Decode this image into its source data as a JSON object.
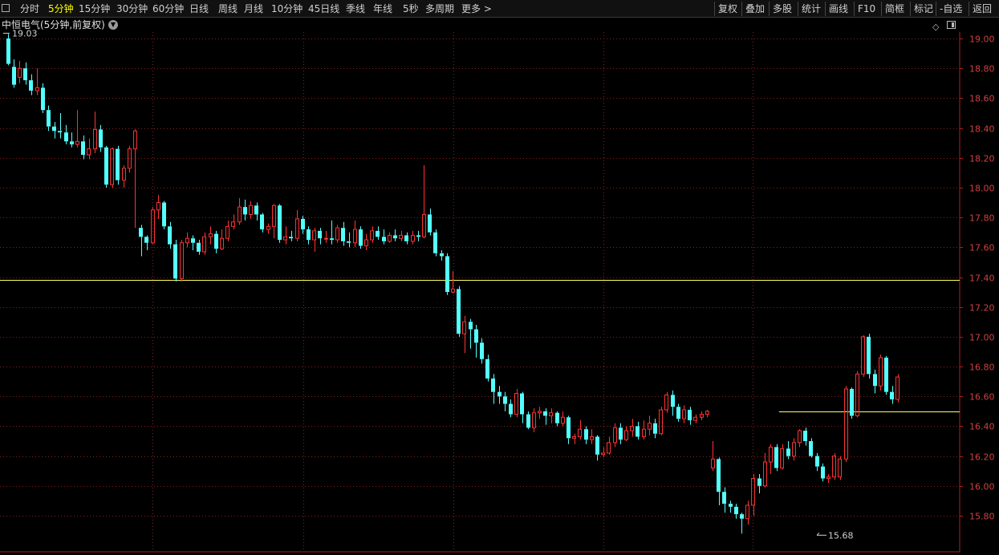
{
  "toolbar": {
    "periods": [
      "分时",
      "5分钟",
      "15分钟",
      "30分钟",
      "60分钟",
      "日线",
      "周线",
      "月线",
      "10分钟",
      "45日线",
      "季线",
      "年线",
      "5秒",
      "多周期",
      "更多 >"
    ],
    "active_period": "5分钟",
    "right_buttons": [
      "复权",
      "叠加",
      "多股",
      "统计",
      "画线",
      "F10",
      "简框",
      "标记",
      "-自选",
      "返回"
    ]
  },
  "title_row": {
    "title": "中恒电气(5分钟,前复权)"
  },
  "colors": {
    "background": "#000000",
    "up": "#ff3232",
    "down": "#54ffff",
    "grid": "#8a1e1e",
    "axis_text": "#d04040",
    "hline": "#ffff66",
    "active": "#ffff00"
  },
  "chart_data": {
    "type": "candlestick",
    "ylim": [
      15.65,
      19.12
    ],
    "y_ticks": [
      "19.00",
      "18.80",
      "18.60",
      "18.40",
      "18.20",
      "18.00",
      "17.80",
      "17.60",
      "17.40",
      "17.20",
      "17.00",
      "16.80",
      "16.60",
      "16.40",
      "16.20",
      "16.00",
      "15.80"
    ],
    "grid": true,
    "max_marker": {
      "label": "19.03",
      "value": 19.03,
      "index": 0
    },
    "min_marker": {
      "label": "15.68",
      "value": 15.68,
      "index": 140
    },
    "horizontal_lines": [
      {
        "value": 17.38,
        "from_index": 0,
        "to_index": 170
      },
      {
        "value": 16.5,
        "from_index": 134,
        "to_index": 170
      }
    ],
    "candles": [
      [
        19.0,
        18.83,
        19.03,
        18.82
      ],
      [
        18.81,
        18.69,
        18.86,
        18.67
      ],
      [
        18.74,
        18.8,
        18.85,
        18.7
      ],
      [
        18.8,
        18.72,
        18.84,
        18.69
      ],
      [
        18.72,
        18.65,
        18.76,
        18.62
      ],
      [
        18.65,
        18.67,
        18.8,
        18.62
      ],
      [
        18.67,
        18.52,
        18.7,
        18.5
      ],
      [
        18.52,
        18.41,
        18.55,
        18.38
      ],
      [
        18.41,
        18.38,
        18.44,
        18.33
      ],
      [
        18.38,
        18.37,
        18.5,
        18.33
      ],
      [
        18.37,
        18.31,
        18.42,
        18.29
      ],
      [
        18.31,
        18.29,
        18.37,
        18.27
      ],
      [
        18.29,
        18.31,
        18.52,
        18.27
      ],
      [
        18.31,
        18.22,
        18.35,
        18.19
      ],
      [
        18.22,
        18.26,
        18.33,
        18.19
      ],
      [
        18.26,
        18.39,
        18.51,
        18.23
      ],
      [
        18.39,
        18.27,
        18.42,
        18.24
      ],
      [
        18.27,
        18.02,
        18.28,
        18.0
      ],
      [
        18.02,
        18.26,
        18.27,
        18.0
      ],
      [
        18.26,
        18.05,
        18.28,
        18.02
      ],
      [
        18.05,
        18.13,
        18.15,
        18.0
      ],
      [
        18.13,
        18.26,
        18.28,
        18.1
      ],
      [
        18.26,
        18.38,
        18.39,
        17.73
      ],
      [
        17.73,
        17.67,
        17.75,
        17.54
      ],
      [
        17.67,
        17.63,
        17.68,
        17.58
      ],
      [
        17.63,
        17.85,
        17.87,
        17.62
      ],
      [
        17.85,
        17.9,
        17.95,
        17.79
      ],
      [
        17.9,
        17.74,
        17.91,
        17.72
      ],
      [
        17.74,
        17.62,
        17.77,
        17.59
      ],
      [
        17.62,
        17.39,
        17.65,
        17.37
      ],
      [
        17.39,
        17.63,
        17.65,
        17.37
      ],
      [
        17.63,
        17.66,
        17.7,
        17.6
      ],
      [
        17.66,
        17.63,
        17.68,
        17.58
      ],
      [
        17.63,
        17.57,
        17.65,
        17.55
      ],
      [
        17.57,
        17.67,
        17.7,
        17.55
      ],
      [
        17.67,
        17.69,
        17.74,
        17.62
      ],
      [
        17.69,
        17.59,
        17.71,
        17.56
      ],
      [
        17.59,
        17.66,
        17.72,
        17.58
      ],
      [
        17.66,
        17.74,
        17.78,
        17.64
      ],
      [
        17.74,
        17.77,
        17.82,
        17.72
      ],
      [
        17.77,
        17.87,
        17.93,
        17.75
      ],
      [
        17.87,
        17.82,
        17.92,
        17.78
      ],
      [
        17.82,
        17.88,
        17.91,
        17.79
      ],
      [
        17.88,
        17.82,
        17.9,
        17.78
      ],
      [
        17.82,
        17.72,
        17.83,
        17.7
      ],
      [
        17.72,
        17.74,
        17.76,
        17.69
      ],
      [
        17.74,
        17.88,
        17.89,
        17.66
      ],
      [
        17.88,
        17.65,
        17.89,
        17.63
      ],
      [
        17.65,
        17.67,
        17.74,
        17.62
      ],
      [
        17.67,
        17.66,
        17.71,
        17.64
      ],
      [
        17.66,
        17.79,
        17.85,
        17.64
      ],
      [
        17.79,
        17.72,
        17.81,
        17.69
      ],
      [
        17.72,
        17.65,
        17.74,
        17.62
      ],
      [
        17.65,
        17.71,
        17.73,
        17.57
      ],
      [
        17.71,
        17.66,
        17.73,
        17.62
      ],
      [
        17.66,
        17.66,
        17.71,
        17.63
      ],
      [
        17.66,
        17.65,
        17.78,
        17.62
      ],
      [
        17.65,
        17.73,
        17.75,
        17.63
      ],
      [
        17.73,
        17.64,
        17.77,
        17.61
      ],
      [
        17.64,
        17.63,
        17.7,
        17.6
      ],
      [
        17.63,
        17.72,
        17.78,
        17.6
      ],
      [
        17.72,
        17.61,
        17.74,
        17.59
      ],
      [
        17.61,
        17.65,
        17.69,
        17.58
      ],
      [
        17.65,
        17.71,
        17.74,
        17.63
      ],
      [
        17.71,
        17.67,
        17.74,
        17.65
      ],
      [
        17.67,
        17.64,
        17.72,
        17.62
      ],
      [
        17.64,
        17.68,
        17.7,
        17.63
      ],
      [
        17.68,
        17.66,
        17.72,
        17.64
      ],
      [
        17.66,
        17.68,
        17.71,
        17.64
      ],
      [
        17.68,
        17.64,
        17.7,
        17.62
      ],
      [
        17.64,
        17.68,
        17.71,
        17.62
      ],
      [
        17.68,
        17.67,
        17.71,
        17.64
      ],
      [
        17.67,
        17.82,
        18.15,
        17.66
      ],
      [
        17.82,
        17.7,
        17.86,
        17.68
      ],
      [
        17.7,
        17.56,
        17.72,
        17.54
      ],
      [
        17.56,
        17.54,
        17.58,
        17.51
      ],
      [
        17.54,
        17.3,
        17.56,
        17.28
      ],
      [
        17.3,
        17.32,
        17.44,
        17.29
      ],
      [
        17.32,
        17.02,
        17.34,
        17.0
      ],
      [
        17.02,
        17.1,
        17.14,
        16.89
      ],
      [
        17.1,
        17.05,
        17.12,
        16.92
      ],
      [
        17.05,
        16.96,
        17.08,
        16.86
      ],
      [
        16.96,
        16.85,
        16.99,
        16.82
      ],
      [
        16.85,
        16.72,
        16.88,
        16.7
      ],
      [
        16.72,
        16.63,
        16.75,
        16.55
      ],
      [
        16.63,
        16.6,
        16.67,
        16.55
      ],
      [
        16.6,
        16.55,
        16.63,
        16.5
      ],
      [
        16.55,
        16.48,
        16.58,
        16.46
      ],
      [
        16.48,
        16.62,
        16.65,
        16.46
      ],
      [
        16.62,
        16.48,
        16.63,
        16.42
      ],
      [
        16.48,
        16.39,
        16.5,
        16.38
      ],
      [
        16.39,
        16.49,
        16.52,
        16.36
      ],
      [
        16.49,
        16.5,
        16.53,
        16.45
      ],
      [
        16.5,
        16.47,
        16.52,
        16.41
      ],
      [
        16.47,
        16.49,
        16.52,
        16.42
      ],
      [
        16.49,
        16.42,
        16.5,
        16.4
      ],
      [
        16.42,
        16.46,
        16.5,
        16.4
      ],
      [
        16.46,
        16.32,
        16.47,
        16.28
      ],
      [
        16.32,
        16.33,
        16.35,
        16.28
      ],
      [
        16.33,
        16.38,
        16.44,
        16.31
      ],
      [
        16.38,
        16.31,
        16.4,
        16.28
      ],
      [
        16.31,
        16.33,
        16.38,
        16.28
      ],
      [
        16.33,
        16.21,
        16.34,
        16.17
      ],
      [
        16.21,
        16.22,
        16.26,
        16.19
      ],
      [
        16.22,
        16.29,
        16.33,
        16.21
      ],
      [
        16.29,
        16.39,
        16.42,
        16.26
      ],
      [
        16.39,
        16.31,
        16.42,
        16.28
      ],
      [
        16.31,
        16.37,
        16.4,
        16.3
      ],
      [
        16.37,
        16.4,
        16.45,
        16.33
      ],
      [
        16.4,
        16.33,
        16.43,
        16.31
      ],
      [
        16.33,
        16.38,
        16.44,
        16.31
      ],
      [
        16.38,
        16.42,
        16.47,
        16.34
      ],
      [
        16.42,
        16.35,
        16.45,
        16.32
      ],
      [
        16.35,
        16.51,
        16.53,
        16.34
      ],
      [
        16.51,
        16.61,
        16.63,
        16.49
      ],
      [
        16.61,
        16.53,
        16.64,
        16.47
      ],
      [
        16.53,
        16.45,
        16.55,
        16.43
      ],
      [
        16.45,
        16.51,
        16.54,
        16.42
      ],
      [
        16.51,
        16.44,
        16.53,
        16.41
      ],
      [
        16.44,
        16.46,
        16.48,
        16.42
      ],
      [
        16.46,
        16.48,
        16.5,
        16.44
      ],
      [
        16.48,
        16.5,
        16.51,
        16.46
      ],
      [
        16.12,
        16.18,
        16.3,
        16.1
      ],
      [
        16.18,
        15.96,
        16.19,
        15.87
      ],
      [
        15.96,
        15.88,
        15.99,
        15.82
      ],
      [
        15.88,
        15.86,
        15.9,
        15.82
      ],
      [
        15.86,
        15.81,
        15.88,
        15.78
      ],
      [
        15.81,
        15.78,
        15.82,
        15.68
      ],
      [
        15.78,
        15.87,
        15.9,
        15.74
      ],
      [
        15.87,
        16.05,
        16.08,
        15.8
      ],
      [
        16.05,
        16.0,
        16.08,
        15.95
      ],
      [
        16.0,
        16.16,
        16.22,
        15.99
      ],
      [
        16.16,
        16.26,
        16.28,
        16.08
      ],
      [
        16.26,
        16.12,
        16.28,
        16.1
      ],
      [
        16.12,
        16.25,
        16.28,
        16.11
      ],
      [
        16.25,
        16.2,
        16.3,
        16.18
      ],
      [
        16.2,
        16.29,
        16.32,
        16.17
      ],
      [
        16.29,
        16.37,
        16.38,
        16.26
      ],
      [
        16.37,
        16.3,
        16.39,
        16.27
      ],
      [
        16.3,
        16.2,
        16.32,
        16.19
      ],
      [
        16.2,
        16.13,
        16.22,
        16.1
      ],
      [
        16.13,
        16.05,
        16.15,
        16.03
      ],
      [
        16.05,
        16.06,
        16.08,
        16.02
      ],
      [
        16.06,
        16.2,
        16.22,
        16.04
      ],
      [
        16.06,
        16.18,
        16.2,
        16.04
      ],
      [
        16.18,
        16.65,
        16.67,
        16.16
      ],
      [
        16.65,
        16.47,
        16.66,
        16.45
      ],
      [
        16.47,
        16.75,
        16.77,
        16.46
      ],
      [
        16.75,
        17.0,
        17.01,
        16.73
      ],
      [
        17.0,
        16.75,
        17.02,
        16.72
      ],
      [
        16.75,
        16.67,
        16.78,
        16.62
      ],
      [
        16.67,
        16.86,
        16.88,
        16.64
      ],
      [
        16.86,
        16.63,
        16.87,
        16.61
      ],
      [
        16.63,
        16.58,
        16.67,
        16.55
      ],
      [
        16.58,
        16.73,
        16.75,
        16.56
      ]
    ]
  }
}
